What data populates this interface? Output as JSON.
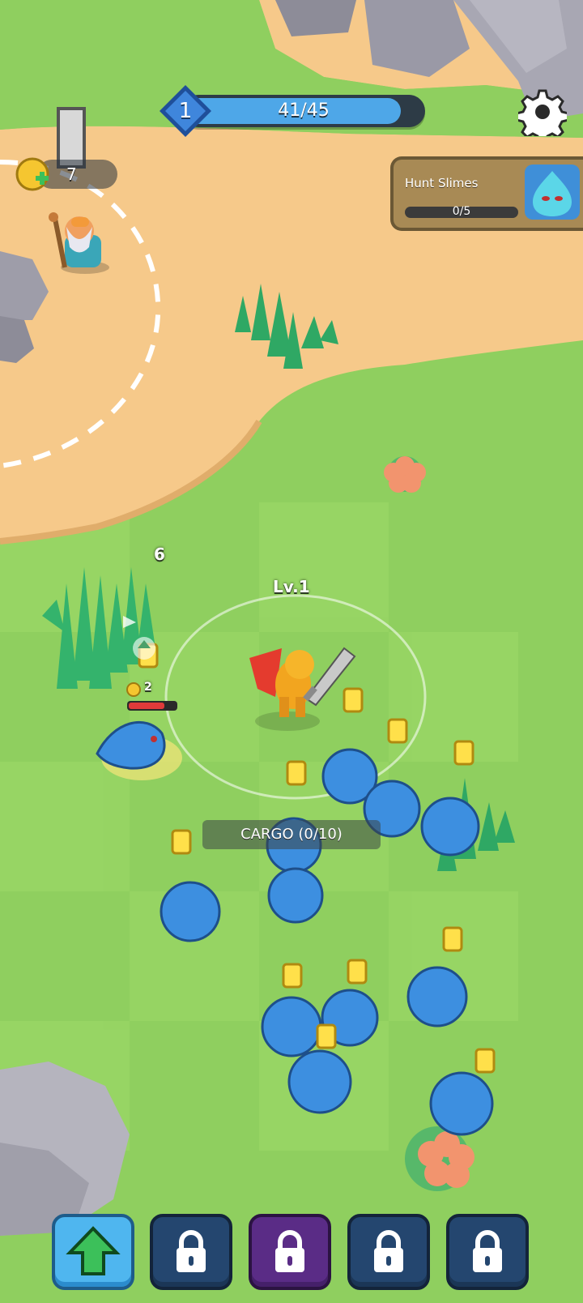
{
  "hud": {
    "level": "1",
    "xp_text": "41/45",
    "xp_fraction": 0.911,
    "coins": "7",
    "settings_icon": "gear-icon"
  },
  "quest": {
    "title": "Hunt Slimes",
    "progress_text": "0/5",
    "progress_fraction": 0,
    "icon": "slime-icon"
  },
  "world": {
    "player_level_label": "Lv.1",
    "cargo_label": "CARGO (0/10)",
    "floating_number": "6",
    "enemy_coin_reward": "2",
    "enemy_health_fraction": 0.75
  },
  "action_bar": [
    {
      "name": "upgrade-button",
      "icon": "arrow-up-icon",
      "locked": false
    },
    {
      "name": "locked-slot-1",
      "icon": "lock-icon",
      "locked": true
    },
    {
      "name": "locked-slot-2",
      "icon": "lock-icon",
      "locked": true
    },
    {
      "name": "locked-slot-3",
      "icon": "lock-icon",
      "locked": true
    },
    {
      "name": "locked-slot-4",
      "icon": "lock-icon",
      "locked": true
    }
  ],
  "colors": {
    "grass": "#8fcf5f",
    "sand": "#f6c98a",
    "xp_fill": "#4ea7e8",
    "slime": "#3d8fe0",
    "quest_panel": "#a88a55"
  }
}
